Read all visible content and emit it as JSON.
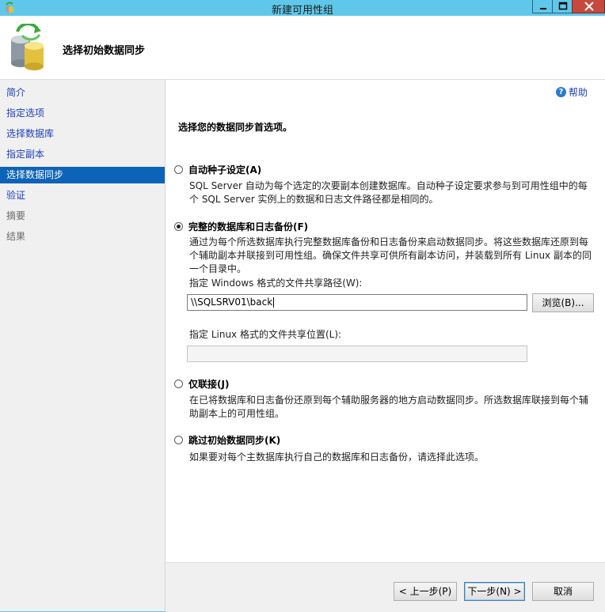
{
  "window": {
    "title": "新建可用性组"
  },
  "header": {
    "title": "选择初始数据同步"
  },
  "nav": {
    "items": [
      {
        "label": "简介"
      },
      {
        "label": "指定选项"
      },
      {
        "label": "选择数据库"
      },
      {
        "label": "指定副本"
      },
      {
        "label": "选择数据同步"
      },
      {
        "label": "验证"
      },
      {
        "label": "摘要"
      },
      {
        "label": "结果"
      }
    ],
    "active_index": 4
  },
  "content": {
    "help_label": "帮助",
    "section_title": "选择您的数据同步首选项。",
    "options": [
      {
        "label": "自动种子设定(A)",
        "selected": false,
        "description": "SQL Server 自动为每个选定的次要副本创建数据库。自动种子设定要求参与到可用性组中的每个 SQL Server 实例上的数据和日志文件路径都是相同的。"
      },
      {
        "label": "完整的数据库和日志备份(F)",
        "selected": true,
        "description": "通过为每个所选数据库执行完整数据库备份和日志备份来启动数据同步。将这些数据库还原到每个辅助副本并联接到可用性组。确保文件共享可供所有副本访问，并装载到所有 Linux 副本的同一个目录中。",
        "windows_share_label": "指定 Windows 格式的文件共享路径(W):",
        "windows_share_value": "\\\\SQLSRV01\\back",
        "browse_label": "浏览(B)...",
        "linux_share_label": "指定 Linux 格式的文件共享位置(L):",
        "linux_share_value": ""
      },
      {
        "label": "仅联接(J)",
        "selected": false,
        "description": "在已将数据库和日志备份还原到每个辅助服务器的地方启动数据同步。所选数据库联接到每个辅助副本上的可用性组。"
      },
      {
        "label": "跳过初始数据同步(K)",
        "selected": false,
        "description": "如果要对每个主数据库执行自己的数据库和日志备份，请选择此选项。"
      }
    ]
  },
  "footer": {
    "prev_label": "< 上一步(P)",
    "next_label": "下一步(N) >",
    "cancel_label": "取消"
  },
  "colors": {
    "titlebar": "#5fc8ea",
    "nav_active": "#0c63b7",
    "link": "#1c3fb7",
    "close_button": "#c7483c"
  }
}
